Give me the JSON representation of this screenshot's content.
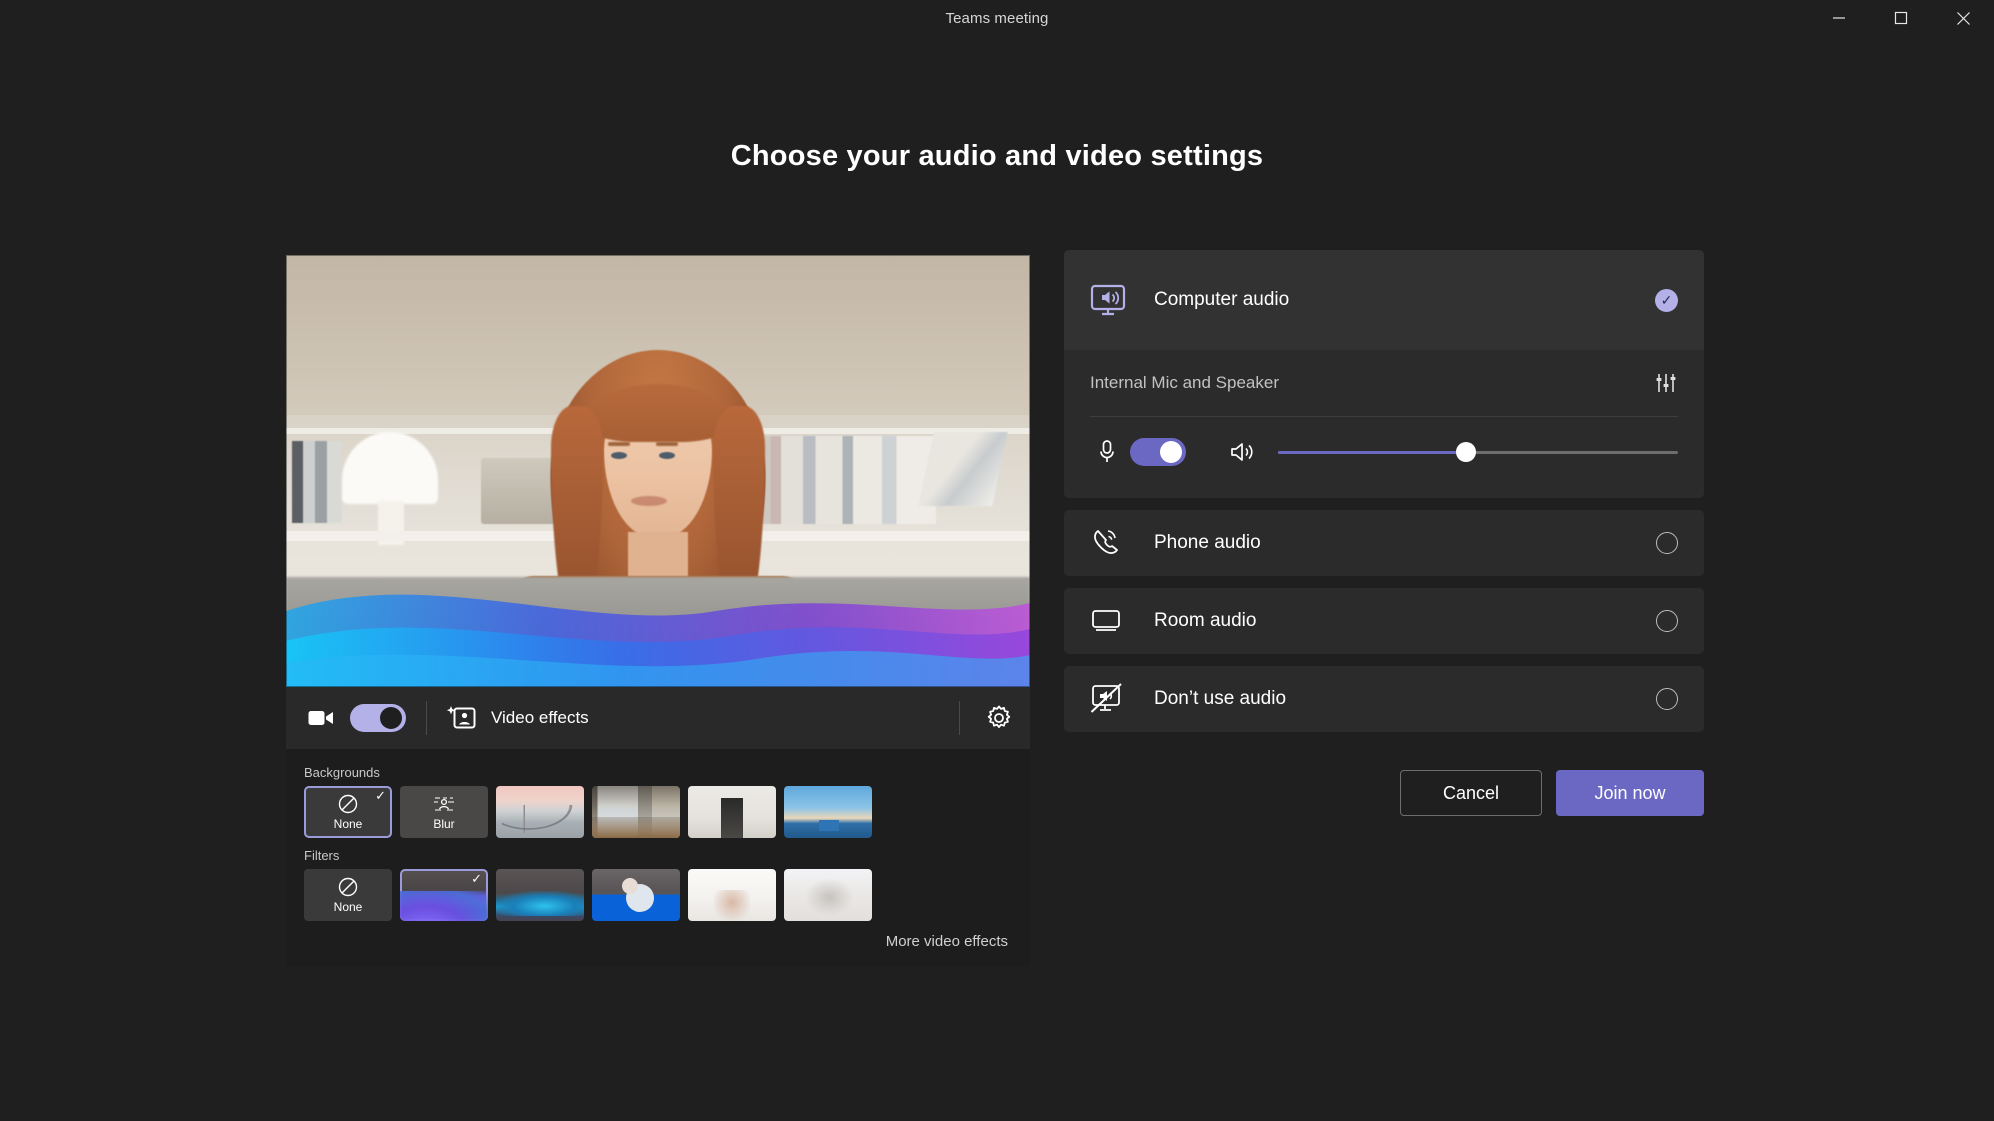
{
  "window": {
    "title": "Teams meeting",
    "controls": {
      "minimize": "minimize-icon",
      "maximize": "maximize-icon",
      "close": "close-icon"
    }
  },
  "page": {
    "heading": "Choose your audio and video settings"
  },
  "video": {
    "preview_alt": "Camera preview of a person with long auburn hair wearing a brown top in a bright room with bookshelves, overlaid with a purple and blue wave filter",
    "toolbar": {
      "camera_icon": "video-camera-icon",
      "camera_toggle_state": "on",
      "video_effects_icon": "video-effects-icon",
      "video_effects_label": "Video effects",
      "settings_icon": "gear-icon"
    },
    "effects": {
      "backgrounds_label": "Backgrounds",
      "backgrounds": [
        {
          "label": "None",
          "icon": "none-slash-icon",
          "selected": true,
          "style": "none-tile"
        },
        {
          "label": "Blur",
          "icon": "blur-icon",
          "selected": false,
          "style": "blur-tile"
        },
        {
          "label": "",
          "icon": "",
          "selected": false,
          "style": "bg-bridge"
        },
        {
          "label": "",
          "icon": "",
          "selected": false,
          "style": "bg-office"
        },
        {
          "label": "",
          "icon": "",
          "selected": false,
          "style": "bg-hall"
        },
        {
          "label": "",
          "icon": "",
          "selected": false,
          "style": "bg-sky"
        }
      ],
      "filters_label": "Filters",
      "filters": [
        {
          "label": "None",
          "icon": "none-slash-icon",
          "selected": false,
          "style": "none-tile"
        },
        {
          "label": "",
          "icon": "",
          "selected": true,
          "style": "fl-purple"
        },
        {
          "label": "",
          "icon": "",
          "selected": false,
          "style": "fl-teal"
        },
        {
          "label": "",
          "icon": "",
          "selected": false,
          "style": "fl-blue"
        },
        {
          "label": "",
          "icon": "",
          "selected": false,
          "style": "fl-white1"
        },
        {
          "label": "",
          "icon": "",
          "selected": false,
          "style": "fl-white2"
        }
      ],
      "more_link": "More video effects"
    }
  },
  "audio": {
    "options": [
      {
        "label": "Computer audio",
        "icon": "computer-audio-icon",
        "selected": true
      },
      {
        "label": "Phone audio",
        "icon": "phone-audio-icon",
        "selected": false
      },
      {
        "label": "Room audio",
        "icon": "room-audio-icon",
        "selected": false
      },
      {
        "label": "Don’t use audio",
        "icon": "no-audio-icon",
        "selected": false
      }
    ],
    "device": {
      "name": "Internal Mic and Speaker",
      "settings_icon": "audio-settings-sliders-icon",
      "mic_icon": "microphone-icon",
      "mic_toggle_state": "on",
      "speaker_icon": "speaker-icon",
      "volume_percent": 47
    }
  },
  "actions": {
    "cancel_label": "Cancel",
    "join_label": "Join now"
  },
  "colors": {
    "accent": "#6b68c4",
    "accent_light": "#b4b0e8",
    "page_bg": "#1f1f1f",
    "card_bg": "#2b2b2b",
    "card_head_bg": "#323232"
  }
}
